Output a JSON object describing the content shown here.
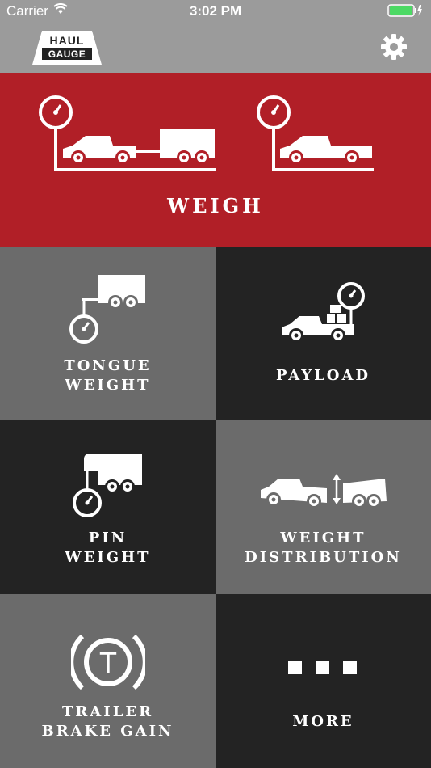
{
  "status": {
    "carrier": "Carrier",
    "time": "3:02 PM"
  },
  "nav": {
    "logo_line1": "HAUL",
    "logo_line2": "GAUGE",
    "settings_icon": "gear-icon"
  },
  "colors": {
    "weigh_bg": "#b11f27",
    "tile_light": "#6b6b6b",
    "tile_dark": "#232323",
    "bar": "#9b9b9b"
  },
  "weigh": {
    "label": "WEIGH"
  },
  "tiles": {
    "tongue": {
      "line1": "TONGUE",
      "line2": "WEIGHT"
    },
    "payload": {
      "line1": "PAYLOAD"
    },
    "pin": {
      "line1": "PIN",
      "line2": "WEIGHT"
    },
    "distribution": {
      "line1": "WEIGHT",
      "line2": "DISTRIBUTION"
    },
    "brake": {
      "line1": "TRAILER",
      "line2": "BRAKE GAIN",
      "icon_letter": "T"
    },
    "more": {
      "line1": "MORE"
    }
  }
}
